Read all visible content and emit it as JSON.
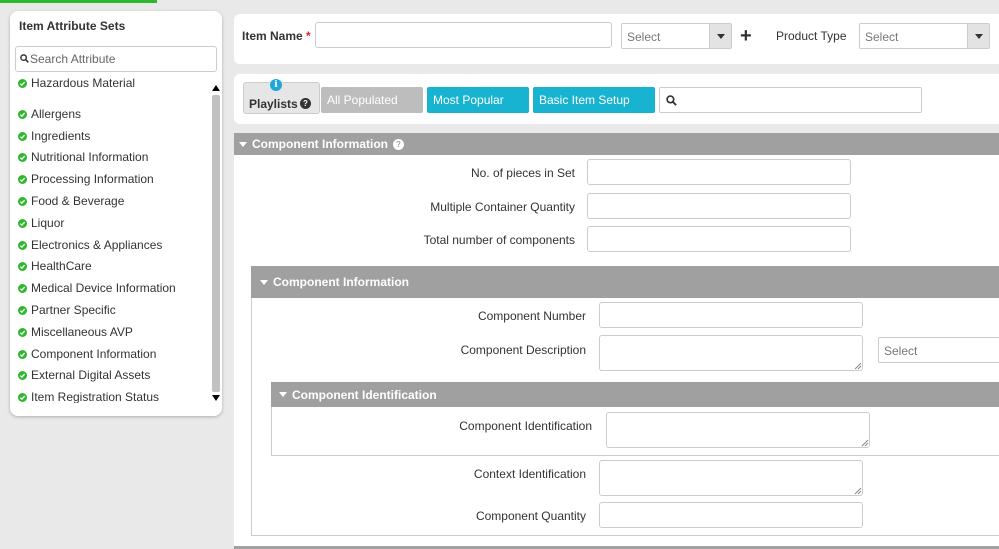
{
  "sidebar": {
    "title": "Item Attribute Sets",
    "search_placeholder": "Search Attribute",
    "items": [
      {
        "label": "Hazardous Material"
      },
      {
        "label": "Allergens"
      },
      {
        "label": "Ingredients"
      },
      {
        "label": "Nutritional Information"
      },
      {
        "label": "Processing Information"
      },
      {
        "label": "Food & Beverage"
      },
      {
        "label": "Liquor"
      },
      {
        "label": "Electronics & Appliances"
      },
      {
        "label": "HealthCare"
      },
      {
        "label": "Medical Device Information"
      },
      {
        "label": "Partner Specific"
      },
      {
        "label": "Miscellaneous AVP"
      },
      {
        "label": "Component Information"
      },
      {
        "label": "External Digital Assets"
      },
      {
        "label": "Item Registration Status"
      }
    ]
  },
  "topbar": {
    "item_name_label": "Item Name",
    "required_mark": "*",
    "item_name_value": "",
    "item_select_value": "Select",
    "add_symbol": "+",
    "product_type_label": "Product Type",
    "product_type_value": "Select"
  },
  "playlists": {
    "label": "Playlists",
    "info_symbol": "i",
    "help_symbol": "?",
    "buttons": {
      "all_populated": "All Populated",
      "most_popular": "Most Popular",
      "basic_item_setup": "Basic Item Setup"
    },
    "search_value": ""
  },
  "component_information": {
    "header": "Component Information",
    "help_symbol": "?",
    "fields": {
      "pieces_in_set": {
        "label": "No. of pieces in Set",
        "value": ""
      },
      "multiple_container_qty": {
        "label": "Multiple Container Quantity",
        "value": ""
      },
      "total_components": {
        "label": "Total number of components",
        "value": ""
      }
    },
    "sub": {
      "header": "Component Information",
      "component_number": {
        "label": "Component Number",
        "value": ""
      },
      "component_description": {
        "label": "Component Description",
        "value": "",
        "select_value": "Select"
      },
      "identification": {
        "header": "Component Identification",
        "component_identification": {
          "label": "Component Identification",
          "value": ""
        }
      },
      "context_identification": {
        "label": "Context Identification",
        "value": ""
      },
      "component_quantity": {
        "label": "Component Quantity",
        "value": ""
      }
    }
  },
  "colors": {
    "accent_green": "#2eb82e",
    "teal_button": "#18b3d1",
    "section_gray": "#a0a0a0",
    "required_red": "#d9232d",
    "info_blue": "#1ea8d8"
  },
  "icons": [
    "search-icon",
    "check-circle-icon",
    "plus-icon",
    "info-icon",
    "help-icon",
    "caret-down-icon",
    "dropdown-arrow-icon"
  ]
}
